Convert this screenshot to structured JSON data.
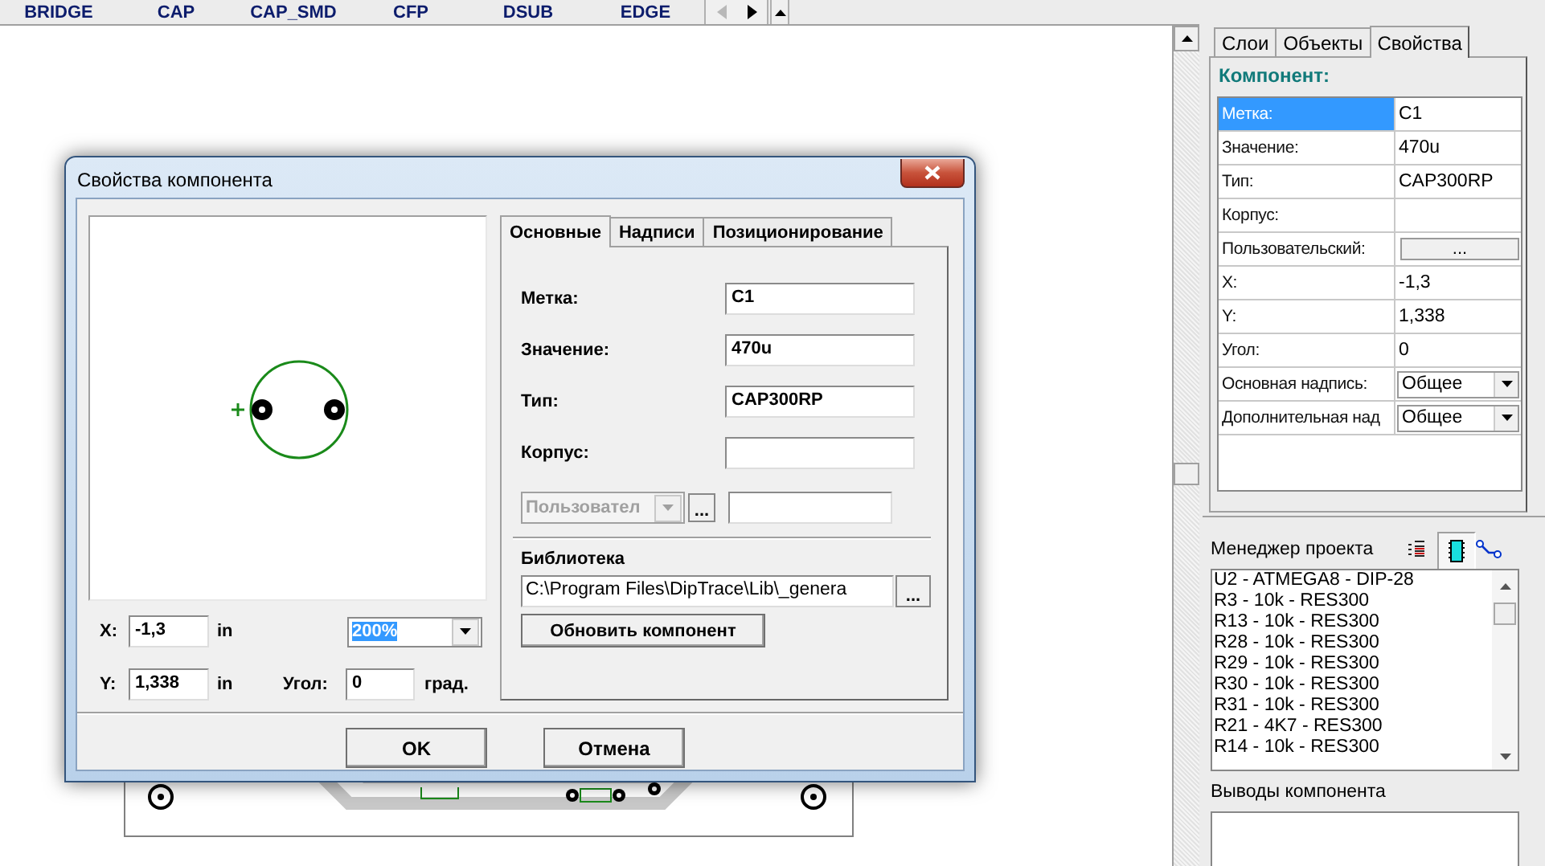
{
  "library_bar": {
    "tabs": [
      "BRIDGE",
      "CAP",
      "CAP_SMD",
      "CFP",
      "DSUB",
      "EDGE"
    ]
  },
  "dialog": {
    "title": "Свойства компонента",
    "tabs": [
      {
        "label": "Основные",
        "selected": true
      },
      {
        "label": "Надписи",
        "selected": false
      },
      {
        "label": "Позиционирование",
        "selected": false
      }
    ],
    "fields": [
      {
        "label": "Метка:",
        "value": "C1"
      },
      {
        "label": "Значение:",
        "value": "470u"
      },
      {
        "label": "Тип:",
        "value": "CAP300RP"
      },
      {
        "label": "Корпус:"
      }
    ],
    "custom": {
      "value": "Пользовател",
      "disabled": true,
      "button": "..."
    },
    "library": {
      "label": "Библиотека",
      "path": "C:\\Program Files\\DipTrace\\Lib\\_genera",
      "button": "..."
    },
    "update_button": "Обновить компонент",
    "position": [
      {
        "label": "X:",
        "value": "-1,3",
        "unit": "in"
      },
      {
        "label": "Y:",
        "value": "1,338",
        "unit": "in"
      }
    ],
    "zoom": "200%",
    "angle": {
      "label": "Угол:",
      "value": "0",
      "unit": "град."
    },
    "buttons": [
      "OK",
      "Отмена"
    ]
  },
  "side_panel": {
    "tabs": [
      {
        "label": "Слои",
        "selected": false
      },
      {
        "label": "Объекты",
        "selected": false
      },
      {
        "label": "Свойства",
        "selected": true
      }
    ],
    "heading": "Компонент:",
    "properties": [
      {
        "name": "Метка:",
        "value": "C1",
        "kind": "text",
        "selected": true
      },
      {
        "name": "Значение:",
        "value": "470u",
        "kind": "text",
        "selected": false
      },
      {
        "name": "Тип:",
        "value": "CAP300RP",
        "kind": "text",
        "selected": false
      },
      {
        "name": "Корпус:",
        "kind": "text",
        "selected": false
      },
      {
        "name": "Пользовательский:",
        "value": "...",
        "kind": "button",
        "selected": false
      },
      {
        "name": "X:",
        "value": "-1,3",
        "kind": "text",
        "selected": false
      },
      {
        "name": "Y:",
        "value": "1,338",
        "kind": "text",
        "selected": false
      },
      {
        "name": "Угол:",
        "value": "0",
        "kind": "text",
        "selected": false
      },
      {
        "name": "Основная надпись:",
        "value": "Общее",
        "kind": "dropdown",
        "selected": false
      },
      {
        "name": "Дополнительная над",
        "value": "Общее",
        "kind": "dropdown",
        "selected": false
      }
    ],
    "project_manager": {
      "title": "Менеджер проекта",
      "items": [
        "U2 - ATMEGA8 - DIP-28",
        "R3 - 10k - RES300",
        "R13 - 10k - RES300",
        "R28 - 10k - RES300",
        "R29 - 10k - RES300",
        "R30 - 10k - RES300",
        "R31 - 10k - RES300",
        "R21 - 4K7 - RES300",
        "R14 - 10k - RES300"
      ]
    },
    "pins": {
      "title": "Выводы компонента"
    }
  }
}
